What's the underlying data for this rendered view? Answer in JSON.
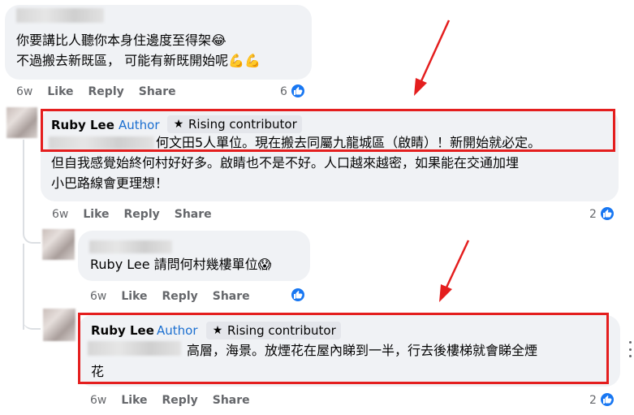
{
  "comments": [
    {
      "text_lines": [
        "你要講比人聽你本身住邊度至得架😂",
        "不過搬去新既區， 可能有新既開始呢💪💪"
      ],
      "actions": {
        "time": "6w",
        "like": "Like",
        "reply": "Reply",
        "share": "Share"
      },
      "reaction_count": "6"
    },
    {
      "name": "Ruby Lee",
      "author_label": "Author",
      "badge": "Rising contributor",
      "text_lines": [
        "何文田5人單位。現在搬去同屬九龍城區（啟睛）！新開始就必定。",
        "但自我感覺始終何村好好多。啟睛也不是不好。人口越來越密，如果能在交通加埋",
        "小巴路線會更理想！"
      ],
      "actions": {
        "time": "6w",
        "like": "Like",
        "reply": "Reply",
        "share": "Share"
      },
      "reaction_count": "2"
    },
    {
      "text": "Ruby Lee 請問何村幾樓單位😱",
      "actions": {
        "time": "6w",
        "like": "Like",
        "reply": "Reply",
        "share": "Share"
      }
    },
    {
      "name": "Ruby Lee",
      "author_label": "Author",
      "badge": "Rising contributor",
      "text_lines": [
        "高層，海景。放煙花在屋內睇到一半，行去後樓梯就會睇全煙",
        "花"
      ],
      "actions": {
        "time": "6w",
        "like": "Like",
        "reply": "Reply",
        "share": "Share"
      },
      "reaction_count": "2"
    }
  ],
  "icons": {
    "like": "thumbs-up-icon",
    "star": "star-icon",
    "more": "more-icon"
  },
  "colors": {
    "annotation": "#e41e1e",
    "facebook_blue": "#1877f2",
    "author_blue": "#1b6fd0",
    "bubble": "#f0f2f5"
  }
}
